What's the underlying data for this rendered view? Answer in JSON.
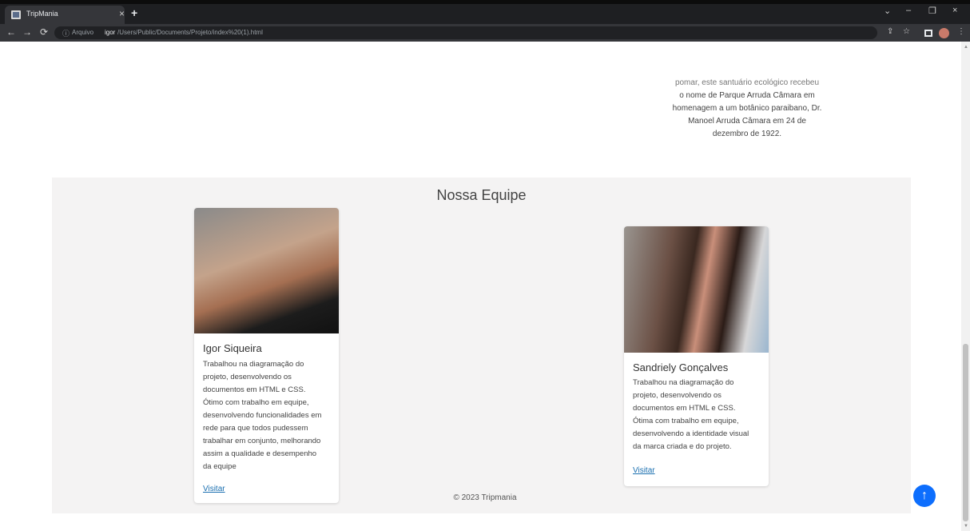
{
  "browser": {
    "tab_title": "TripMania",
    "tab_close": "×",
    "new_tab": "+",
    "window": {
      "chevron": "⌄",
      "minimize": "–",
      "restore": "❐",
      "close": "×"
    },
    "nav": {
      "back": "←",
      "forward": "→",
      "reload": "⟳"
    },
    "address": {
      "info_icon": "ⓘ",
      "scheme_label": "Arquivo",
      "host": "igor",
      "path": "/Users/Public/Documents/Projeto/index%20(1).html"
    },
    "toolbar_icons": {
      "share": "⇪",
      "bookmark": "☆"
    }
  },
  "history": {
    "lines": [
      "pomar, este santuário ecológico recebeu",
      "o nome de Parque Arruda Câmara em",
      "homenagem a um botânico paraibano, Dr.",
      "Manoel Arruda Câmara em 24 de",
      "dezembro de 1922."
    ]
  },
  "team": {
    "title": "Nossa Equipe",
    "members": [
      {
        "name": "Igor Siqueira",
        "description_lines": [
          "Trabalhou na diagramação do",
          "projeto, desenvolvendo os",
          "documentos em HTML e CSS.",
          "Ótimo com trabalho em equipe,",
          "desenvolvendo funcionalidades em",
          "rede para que todos pudessem",
          "trabalhar em conjunto, melhorando",
          "assim a qualidade e desempenho",
          "da equipe"
        ],
        "link": "Visitar"
      },
      {
        "name": "Sandriely Gonçalves",
        "description_lines": [
          "Trabalhou na diagramação do",
          "projeto, desenvolvendo os",
          "documentos em HTML e CSS.",
          "Ótima com trabalho em equipe,",
          "desenvolvendo a identidade visual",
          "da marca criada e do projeto."
        ],
        "link": "Visitar"
      }
    ]
  },
  "footer": {
    "text": "© 2023 Tripmania"
  },
  "back_to_top": {
    "icon": "↑"
  },
  "colors": {
    "accent": "#0d6efd",
    "link": "#1a6fb0",
    "section_bg": "#f4f3f3"
  }
}
